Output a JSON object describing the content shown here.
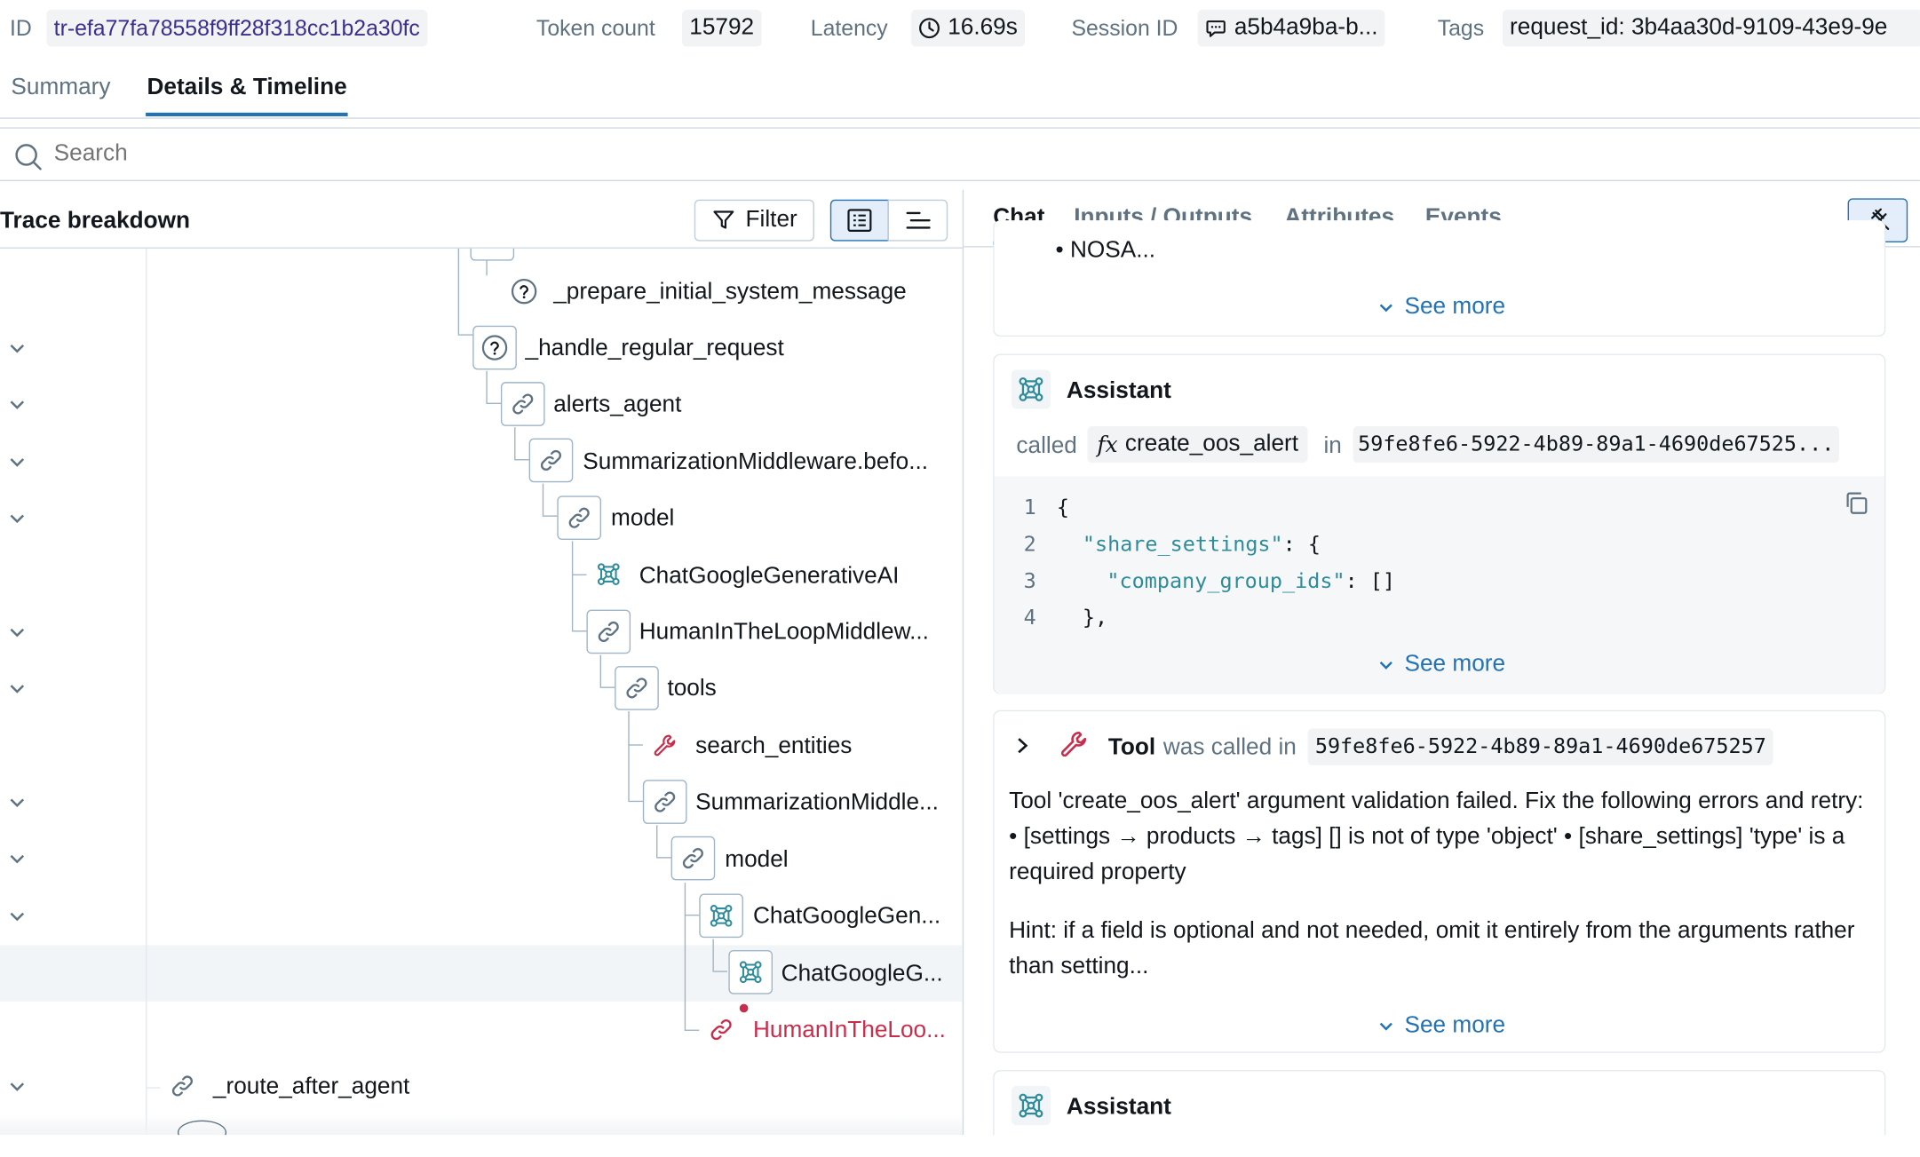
{
  "header": {
    "id_label": "ID",
    "id_value": "tr-efa77fa78558f9ff28f318cc1b2a30fc",
    "token_label": "Token count",
    "token_value": "15792",
    "latency_label": "Latency",
    "latency_value": "16.69s",
    "session_label": "Session ID",
    "session_value": "a5b4a9ba-b...",
    "tags_label": "Tags",
    "tags_value": "request_id: 3b4aa30d-9109-43e9-9e"
  },
  "tabs": {
    "summary": "Summary",
    "details": "Details & Timeline"
  },
  "search": {
    "placeholder": "Search"
  },
  "trace": {
    "title": "Trace breakdown",
    "filter_label": "Filter",
    "nodes": [
      {
        "label": "_prepare_initial_system_message"
      },
      {
        "label": "_handle_regular_request"
      },
      {
        "label": "alerts_agent"
      },
      {
        "label": "SummarizationMiddleware.befo..."
      },
      {
        "label": "model"
      },
      {
        "label": "ChatGoogleGenerativeAI"
      },
      {
        "label": "HumanInTheLoopMiddlew..."
      },
      {
        "label": "tools"
      },
      {
        "label": "search_entities"
      },
      {
        "label": "SummarizationMiddle..."
      },
      {
        "label": "model"
      },
      {
        "label": "ChatGoogleGen..."
      },
      {
        "label": "ChatGoogleG..."
      },
      {
        "label": "HumanInTheLoo..."
      },
      {
        "label": "_route_after_agent"
      }
    ]
  },
  "detail_tabs": {
    "chat": "Chat",
    "io": "Inputs / Outputs",
    "attributes": "Attributes",
    "events": "Events"
  },
  "chat": {
    "top_fragment": "NOSA...",
    "see_more": "See more",
    "assistant_label": "Assistant",
    "called_label": "called",
    "function_name": "create_oos_alert",
    "in_label": "in",
    "call_id": "59fe8fe6-5922-4b89-89a1-4690de67525...",
    "code": {
      "l1": "{",
      "l2_key": "\"share_settings\"",
      "l2_rest": ": {",
      "l3_key": "\"company_group_ids\"",
      "l3_rest": ": []",
      "l4": "},",
      "n1": "1",
      "n2": "2",
      "n3": "3",
      "n4": "4"
    },
    "tool_label": "Tool",
    "tool_called_in": "was called in",
    "tool_call_id": "59fe8fe6-5922-4b89-89a1-4690de675257",
    "tool_error": "Tool 'create_oos_alert' argument validation failed. Fix the following errors and retry: • [settings → products → tags] [] is not of type 'object' • [share_settings] 'type' is a required property",
    "tool_hint": "Hint: if a field is optional and not needed, omit it entirely from the arguments rather than setting...",
    "assistant2_label": "Assistant"
  },
  "colors": {
    "accent": "#2272b4",
    "error": "#c82d4c",
    "text": "#11171c",
    "muted": "#5f7281"
  }
}
